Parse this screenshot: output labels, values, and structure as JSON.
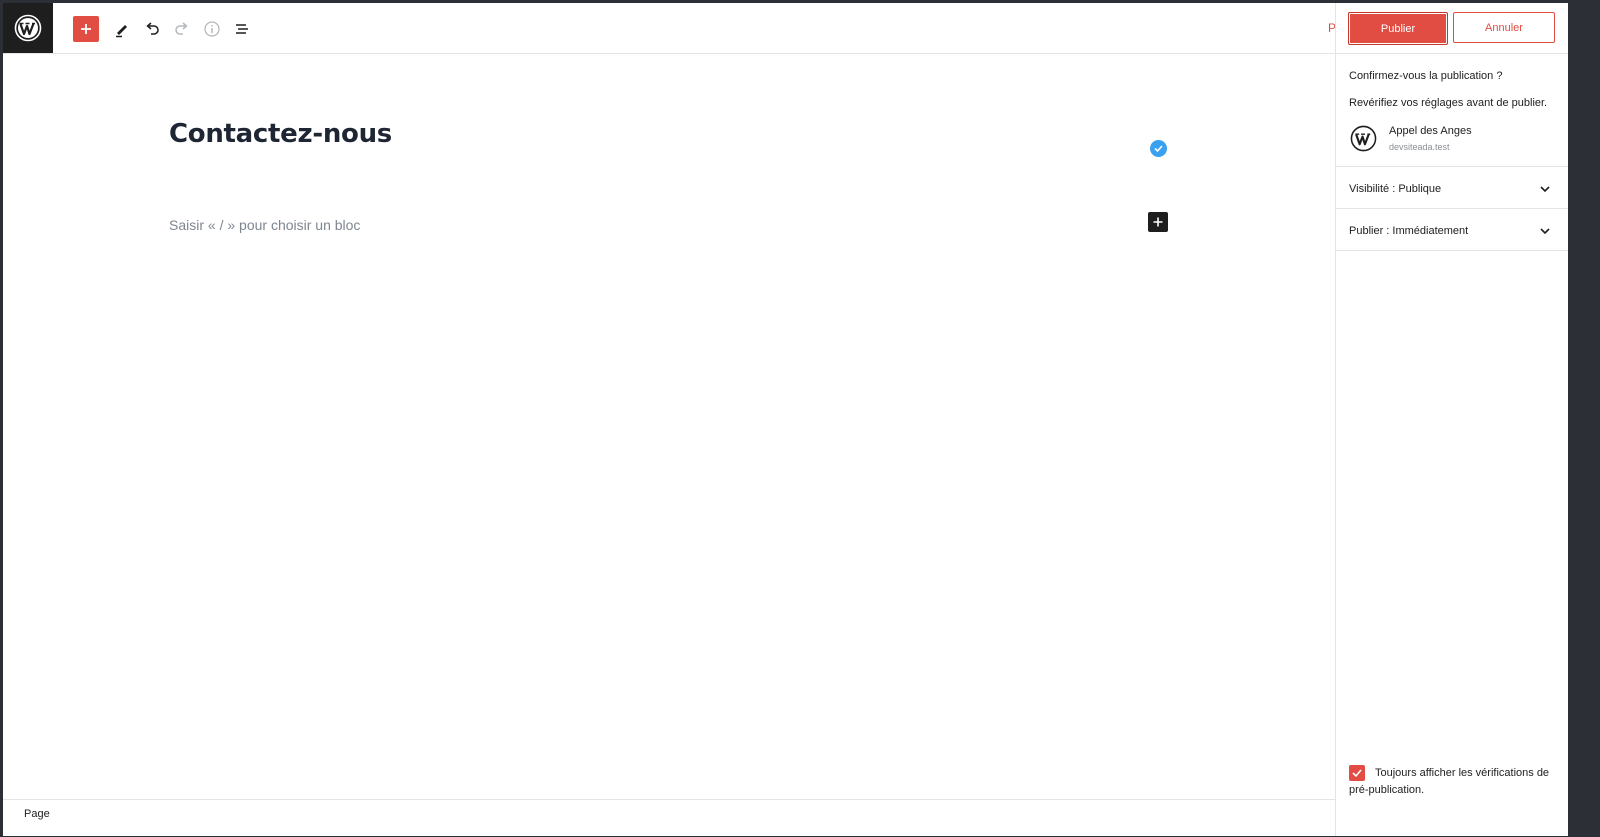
{
  "toolbar": {
    "add_block_icon": "plus-icon",
    "tools_icon": "pencil-icon",
    "undo_icon": "undo-icon",
    "redo_icon": "redo-icon",
    "info_icon": "info-icon",
    "outline_icon": "list-view-icon",
    "clipped_text": "P"
  },
  "editor": {
    "title": "Contactez-nous",
    "block_placeholder": "Saisir « / » pour choisir un bloc"
  },
  "footer": {
    "breadcrumb": "Page"
  },
  "sidebar": {
    "publish_label": "Publier",
    "cancel_label": "Annuler",
    "confirm_title": "Confirmez-vous la publication ?",
    "confirm_desc": "Revérifiez vos réglages avant de publier.",
    "site_name": "Appel des Anges",
    "site_url": "devsiteada.test",
    "panels": [
      {
        "label": "Visibilité : Publique"
      },
      {
        "label": "Publier : Immédiatement"
      }
    ],
    "prepublish_checks_label": "Toujours afficher les vérifications de pré-publication.",
    "prepublish_checked": true
  },
  "colors": {
    "accent": "#e14d43",
    "dark": "#1e1e1e",
    "check_blue": "#3aa0f0"
  }
}
